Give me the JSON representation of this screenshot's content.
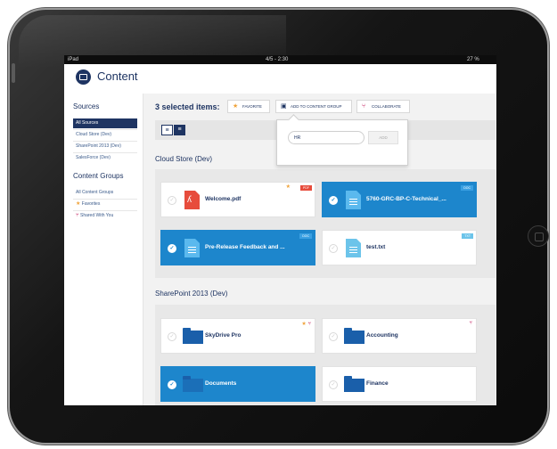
{
  "status_bar": {
    "device": "iPad",
    "time": "4/5 - 2:30",
    "battery": "27 %"
  },
  "app": {
    "title": "Content",
    "logo_icon": "content-box-icon"
  },
  "sidebar": {
    "sources_heading": "Sources",
    "sources": [
      {
        "label": "All Sources",
        "active": true
      },
      {
        "label": "Cloud Store (Dev)",
        "active": false
      },
      {
        "label": "SharePoint 2013 (Dev)",
        "active": false
      },
      {
        "label": "SalesForce (Dev)",
        "active": false
      }
    ],
    "groups_heading": "Content Groups",
    "groups": [
      {
        "label": "All Content Groups",
        "icon": ""
      },
      {
        "label": "Favorites",
        "icon": "star-icon"
      },
      {
        "label": "Shared With You",
        "icon": "collaborate-icon"
      }
    ]
  },
  "toolbar": {
    "selection_label": "3 selected items:",
    "favorite_label": "FAVORITE",
    "add_group_label": "ADD TO CONTENT GROUP",
    "collaborate_label": "COLLABORATE"
  },
  "popover": {
    "input_value": "HR",
    "add_label": "ADD"
  },
  "sections": [
    {
      "title": "Cloud Store (Dev)",
      "items": [
        {
          "name": "Welcome.pdf",
          "type": "PDF",
          "selected": false,
          "favorite": true,
          "shared": false
        },
        {
          "name": "5760-GRC-BP-C-Technical_...",
          "type": "DOC",
          "selected": true,
          "favorite": false,
          "shared": false
        },
        {
          "name": "Pre-Release Feedback and ...",
          "type": "DOC",
          "selected": true,
          "favorite": false,
          "shared": false
        },
        {
          "name": "test.txt",
          "type": "TXT",
          "selected": false,
          "favorite": false,
          "shared": false
        }
      ]
    },
    {
      "title": "SharePoint 2013 (Dev)",
      "items": [
        {
          "name": "SkyDrive Pro",
          "type": "folder",
          "selected": false,
          "favorite": true,
          "shared": true
        },
        {
          "name": "Accounting",
          "type": "folder",
          "selected": false,
          "favorite": false,
          "shared": true
        },
        {
          "name": "Documents",
          "type": "folder",
          "selected": true,
          "favorite": false,
          "shared": false
        },
        {
          "name": "Finance",
          "type": "folder",
          "selected": false,
          "favorite": false,
          "shared": false
        }
      ]
    }
  ],
  "colors": {
    "navy": "#1e3462",
    "selected_blue": "#1d86cc",
    "pdf_red": "#e74c3c",
    "doc_blue": "#2e9ee0",
    "txt_blue": "#6cc4ea",
    "folder_blue": "#1a5faa",
    "star_orange": "#f0a33a",
    "collab_magenta": "#c2185b"
  }
}
